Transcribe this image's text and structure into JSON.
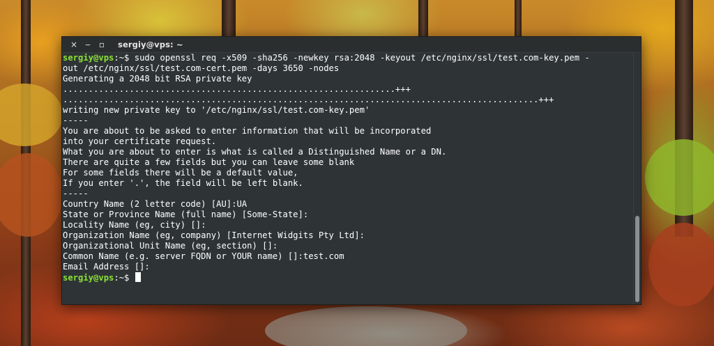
{
  "window": {
    "title": "sergiy@vps: ~",
    "close_glyph": "×",
    "minimize_glyph": "‒",
    "maximize_glyph": "▫"
  },
  "terminal": {
    "prompt_user": "sergiy@vps",
    "prompt_path": ":~$ ",
    "command": "sudo openssl req -x509 -sha256 -newkey rsa:2048 -keyout /etc/nginx/ssl/test.com-key.pem -",
    "output_lines": [
      "out /etc/nginx/ssl/test.com-cert.pem -days 3650 -nodes",
      "Generating a 2048 bit RSA private key",
      ".................................................................+++",
      ".............................................................................................+++",
      "writing new private key to '/etc/nginx/ssl/test.com-key.pem'",
      "-----",
      "You are about to be asked to enter information that will be incorporated",
      "into your certificate request.",
      "What you are about to enter is what is called a Distinguished Name or a DN.",
      "There are quite a few fields but you can leave some blank",
      "For some fields there will be a default value,",
      "If you enter '.', the field will be left blank.",
      "-----",
      "Country Name (2 letter code) [AU]:UA",
      "State or Province Name (full name) [Some-State]:",
      "Locality Name (eg, city) []:",
      "Organization Name (eg, company) [Internet Widgits Pty Ltd]:",
      "Organizational Unit Name (eg, section) []:",
      "Common Name (e.g. server FQDN or YOUR name) []:test.com",
      "Email Address []:"
    ],
    "final_prompt_user": "sergiy@vps",
    "final_prompt_path": ":~$ ",
    "colors": {
      "background": "#2e3436",
      "prompt_user": "#8ae234",
      "text": "#ffffff"
    }
  }
}
